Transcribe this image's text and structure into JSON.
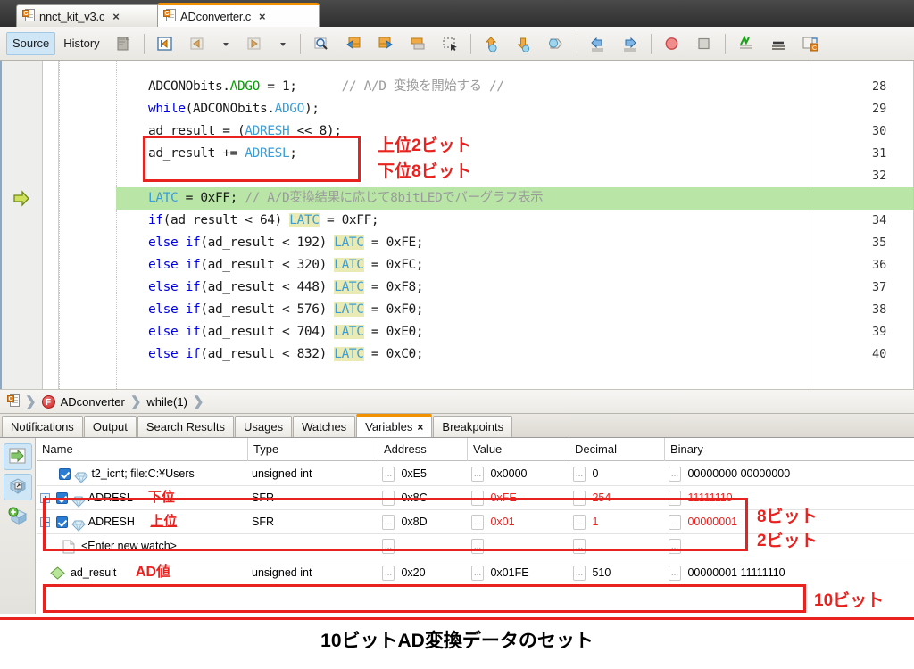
{
  "window": {
    "tabs": [
      {
        "label": "nnct_kit_v3.c",
        "active": false,
        "close": "×"
      },
      {
        "label": "ADconverter.c",
        "active": true,
        "close": "×"
      }
    ]
  },
  "toolbar": {
    "source_label": "Source",
    "history_label": "History",
    "icons": [
      "refactor-icon",
      "toggle-bookmark-icon",
      "back-arrow-icon",
      "back-dropdown-icon",
      "forward-arrow-icon",
      "forward-dropdown-icon",
      "find-selection-icon",
      "previous-bookmark-icon",
      "next-bookmark-icon",
      "toggle-rectangular-selection-icon",
      "last-edit-icon",
      "shift-left-icon",
      "shift-right-icon",
      "comment-icon",
      "uncomment-icon",
      "toggle-breakpoint-icon",
      "stop-icon",
      "new-breakpoint-icon",
      "step-over-icon",
      "compile-file-icon"
    ]
  },
  "editor": {
    "margin_line_color": "#f7b8b8",
    "exec_line_number": 33,
    "lines": [
      {
        "num": "28",
        "indent": 8,
        "tokens": [
          {
            "t": "ADCONObits.",
            "c": "plain"
          },
          {
            "t": "ADGO",
            "c": "green"
          },
          {
            "t": " = 1;",
            "c": "plain"
          },
          {
            "t": "      // A/D 変換を開始する //",
            "c": "comment"
          }
        ]
      },
      {
        "num": "29",
        "indent": 8,
        "tokens": [
          {
            "t": "while",
            "c": "kw"
          },
          {
            "t": "(ADCONObits.",
            "c": "plain"
          },
          {
            "t": "ADGO",
            "c": "blue"
          },
          {
            "t": ");",
            "c": "plain"
          }
        ]
      },
      {
        "num": "30",
        "indent": 8,
        "tokens": [
          {
            "t": "ad_result = (",
            "c": "plain"
          },
          {
            "t": "ADRESH",
            "c": "blue"
          },
          {
            "t": " << 8);",
            "c": "plain"
          }
        ]
      },
      {
        "num": "31",
        "indent": 8,
        "tokens": [
          {
            "t": "ad_result += ",
            "c": "plain"
          },
          {
            "t": "ADRESL",
            "c": "blue"
          },
          {
            "t": ";",
            "c": "plain"
          }
        ]
      },
      {
        "num": "32",
        "indent": 8,
        "tokens": []
      },
      {
        "num": "",
        "exec": true,
        "indent": 8,
        "tokens": [
          {
            "t": "LATC",
            "c": "blue"
          },
          {
            "t": " = 0xFF; ",
            "c": "plain"
          },
          {
            "t": "// A/D変換結果に応じて8bitLEDでバーグラフ表示",
            "c": "comment"
          }
        ]
      },
      {
        "num": "34",
        "indent": 8,
        "tokens": [
          {
            "t": "if",
            "c": "kw"
          },
          {
            "t": "(ad_result < 64) ",
            "c": "plain"
          },
          {
            "t": "LATC",
            "c": "hlblue"
          },
          {
            "t": " = 0xFF;",
            "c": "plain"
          }
        ]
      },
      {
        "num": "35",
        "indent": 8,
        "tokens": [
          {
            "t": "else if",
            "c": "kw"
          },
          {
            "t": "(ad_result < 192) ",
            "c": "plain"
          },
          {
            "t": "LATC",
            "c": "hlblue"
          },
          {
            "t": " = 0xFE;",
            "c": "plain"
          }
        ]
      },
      {
        "num": "36",
        "indent": 8,
        "tokens": [
          {
            "t": "else if",
            "c": "kw"
          },
          {
            "t": "(ad_result < 320) ",
            "c": "plain"
          },
          {
            "t": "LATC",
            "c": "hlblue"
          },
          {
            "t": " = 0xFC;",
            "c": "plain"
          }
        ]
      },
      {
        "num": "37",
        "indent": 8,
        "tokens": [
          {
            "t": "else if",
            "c": "kw"
          },
          {
            "t": "(ad_result < 448) ",
            "c": "plain"
          },
          {
            "t": "LATC",
            "c": "hlblue"
          },
          {
            "t": " = 0xF8;",
            "c": "plain"
          }
        ]
      },
      {
        "num": "38",
        "indent": 8,
        "tokens": [
          {
            "t": "else if",
            "c": "kw"
          },
          {
            "t": "(ad_result < 576) ",
            "c": "plain"
          },
          {
            "t": "LATC",
            "c": "hlblue"
          },
          {
            "t": " = 0xF0;",
            "c": "plain"
          }
        ]
      },
      {
        "num": "39",
        "indent": 8,
        "tokens": [
          {
            "t": "else if",
            "c": "kw"
          },
          {
            "t": "(ad_result < 704) ",
            "c": "plain"
          },
          {
            "t": "LATC",
            "c": "hlblue"
          },
          {
            "t": " = 0xE0;",
            "c": "plain"
          }
        ]
      },
      {
        "num": "40",
        "indent": 8,
        "tokens": [
          {
            "t": "else if",
            "c": "kw"
          },
          {
            "t": "(ad_result < 832) ",
            "c": "plain"
          },
          {
            "t": "LATC",
            "c": "hlblue"
          },
          {
            "t": " = 0xC0;",
            "c": "plain"
          }
        ]
      }
    ],
    "annotations": [
      {
        "name": "code-upper-2bit-label",
        "text": "上位2ビット"
      },
      {
        "name": "code-lower-8bit-label",
        "text": "下位8ビット"
      }
    ]
  },
  "breadcrumb": {
    "items": [
      "ADconverter",
      "while(1)"
    ],
    "chevron": "❯"
  },
  "panel_tabs": [
    {
      "label": "Notifications",
      "active": false
    },
    {
      "label": "Output",
      "active": false
    },
    {
      "label": "Search Results",
      "active": false
    },
    {
      "label": "Usages",
      "active": false
    },
    {
      "label": "Watches",
      "active": false
    },
    {
      "label": "Variables",
      "active": true,
      "close": "×"
    },
    {
      "label": "Breakpoints",
      "active": false
    }
  ],
  "variables": {
    "side_buttons": [
      "step-into-watch-icon",
      "evaluate-expression-icon",
      "new-watch-icon"
    ],
    "columns": [
      "Name",
      "Type",
      "Address",
      "Value",
      "Decimal",
      "Binary"
    ],
    "rows": [
      {
        "expand": false,
        "checked": true,
        "icon": "variable-gem-icon",
        "name": "t2_icnt; file:C:¥Users",
        "annot": "",
        "type": "unsigned int",
        "address": "0xE5",
        "value": "0x0000",
        "decimal": "0",
        "binary": "00000000 00000000",
        "red": false,
        "ellipsis": "..."
      },
      {
        "expand": true,
        "checked": true,
        "icon": "variable-gem-icon",
        "name": "ADRESL",
        "annot": "下位",
        "type": "SFR",
        "address": "0x8C",
        "value": "0xFE",
        "decimal": "254",
        "binary": "11111110",
        "red": true,
        "ellipsis": "..."
      },
      {
        "expand": true,
        "checked": true,
        "icon": "variable-gem-icon",
        "name": "ADRESH",
        "annot": "上位",
        "type": "SFR",
        "address": "0x8D",
        "value": "0x01",
        "decimal": "1",
        "binary": "00000001",
        "red": true,
        "ellipsis": "..."
      },
      {
        "expand": false,
        "checked": null,
        "icon": "new-watch-page-icon",
        "name": "<Enter new watch>",
        "annot": "",
        "type": "",
        "address": "",
        "value": "",
        "decimal": "",
        "binary": "",
        "red": false,
        "ellipsis": "..."
      },
      {
        "expand": false,
        "checked": null,
        "icon": "local-variable-diamond-icon",
        "name": "ad_result",
        "annot": "AD値",
        "type": "unsigned int",
        "address": "0x20",
        "value": "0x01FE",
        "decimal": "510",
        "binary": "00000001 11111110",
        "red": false,
        "ellipsis": "..."
      }
    ],
    "annotations": [
      {
        "name": "adresl-bits-label",
        "text": "8ビット"
      },
      {
        "name": "adresh-bits-label",
        "text": "2ビット"
      },
      {
        "name": "adresult-bits-label",
        "text": "10ビット"
      }
    ]
  },
  "caption": {
    "text": "10ビットAD変換データのセット"
  },
  "colors": {
    "accent_orange": "#f19100",
    "annotation_red": "#e8221f",
    "exec_line_green": "#b9e6a6",
    "highlight_yellow": "#eaeab4"
  }
}
